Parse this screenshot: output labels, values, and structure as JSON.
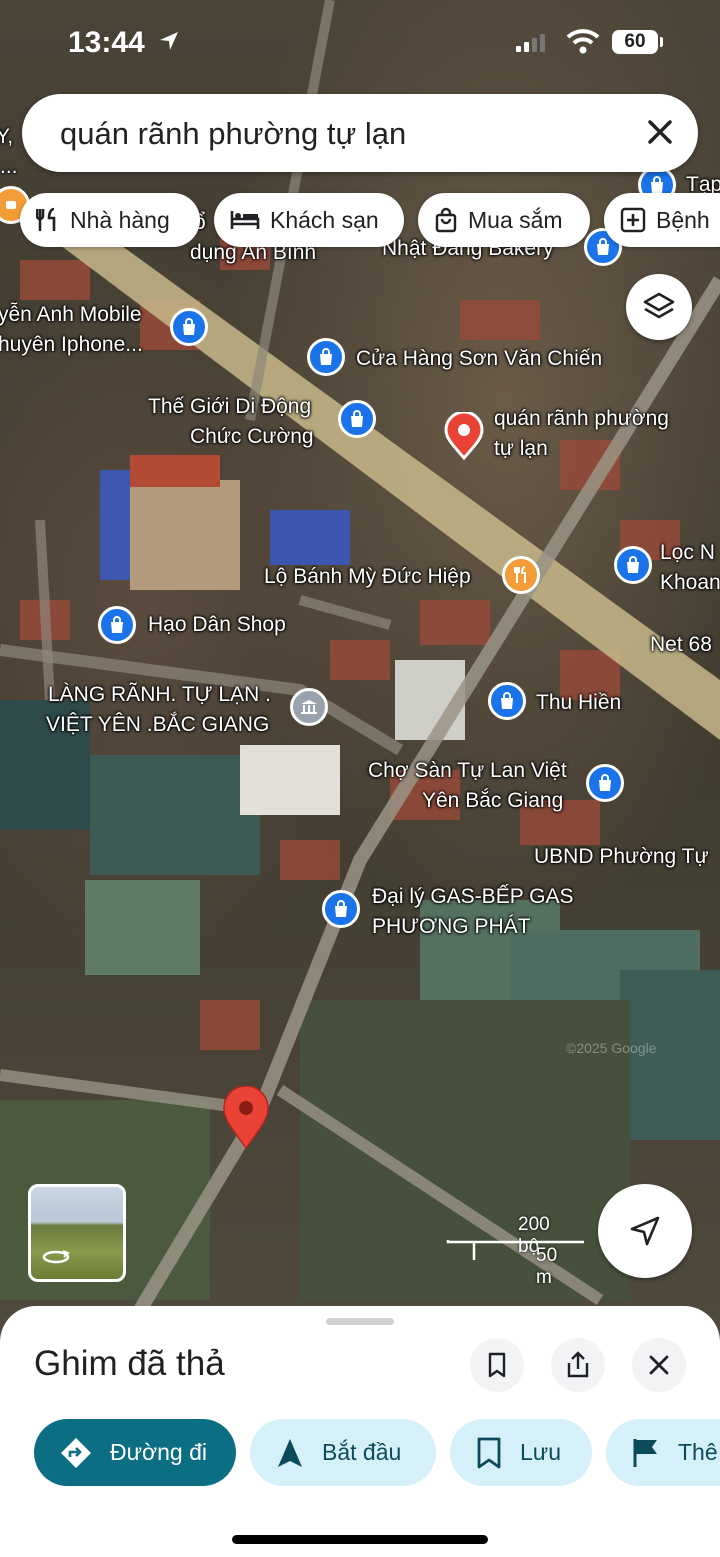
{
  "status_bar": {
    "time": "13:44",
    "battery": "60"
  },
  "search": {
    "query": "quán rãnh phường tự lạn"
  },
  "chips": [
    {
      "label": "Nhà hàng",
      "icon": "restaurant-icon"
    },
    {
      "label": "Khách sạn",
      "icon": "hotel-icon"
    },
    {
      "label": "Mua sắm",
      "icon": "shopping-icon"
    },
    {
      "label": "Bệnh",
      "icon": "hospital-icon"
    }
  ],
  "map_labels": {
    "edge_left_1": "Y,",
    "edge_left_2": "...",
    "an_binh": "dụng An Bình",
    "an_binh_prefix": "ổ",
    "nhat_dang": "Nhật Đăng Bakery",
    "tap": "Tạp",
    "yen_anh_1": "yễn Anh Mobile",
    "yen_anh_2": "huyên Iphone...",
    "son_van_chien": "Cửa Hàng Sơn Văn Chiến",
    "the_gioi_1": "Thế Giới Di Động",
    "the_gioi_2": "Chức Cường",
    "searched_1": "quán rãnh phường",
    "searched_2": "tự lạn",
    "loc_1": "Lọc N",
    "loc_2": "Khoan",
    "banh_my": "Lộ Bánh Mỳ Đức Hiệp",
    "hao_dan": "Hạo Dân Shop",
    "net68": "Net 68",
    "lang_ranh_1": "LÀNG RÃNH. TỰ LẠN .",
    "lang_ranh_2": "VIỆT YÊN .BẮC GIANG",
    "thu_hien": "Thu Hiền",
    "cho_san_1": "Chợ Sàn Tự Lan Việt",
    "cho_san_2": "Yên Bắc Giang",
    "ubnd": "UBND Phường Tự",
    "gas_1": "Đại lý GAS-BẾP GAS",
    "gas_2": "PHƯƠNG PHÁT",
    "copyright": "©2025 Google"
  },
  "scale": {
    "imperial": "200 bộ",
    "metric": "50 m"
  },
  "sheet": {
    "title": "Ghim đã thả",
    "actions": [
      {
        "label": "Đường đi",
        "icon": "directions-icon"
      },
      {
        "label": "Bắt đầu",
        "icon": "navigation-icon"
      },
      {
        "label": "Lưu",
        "icon": "bookmark-icon"
      },
      {
        "label": "Thê",
        "icon": "flag-icon"
      }
    ]
  },
  "colors": {
    "primary_action": "#0b6e82",
    "secondary_action": "#d6f0f9",
    "poi_blue": "#1a73e8",
    "pin_red": "#ea4335"
  }
}
